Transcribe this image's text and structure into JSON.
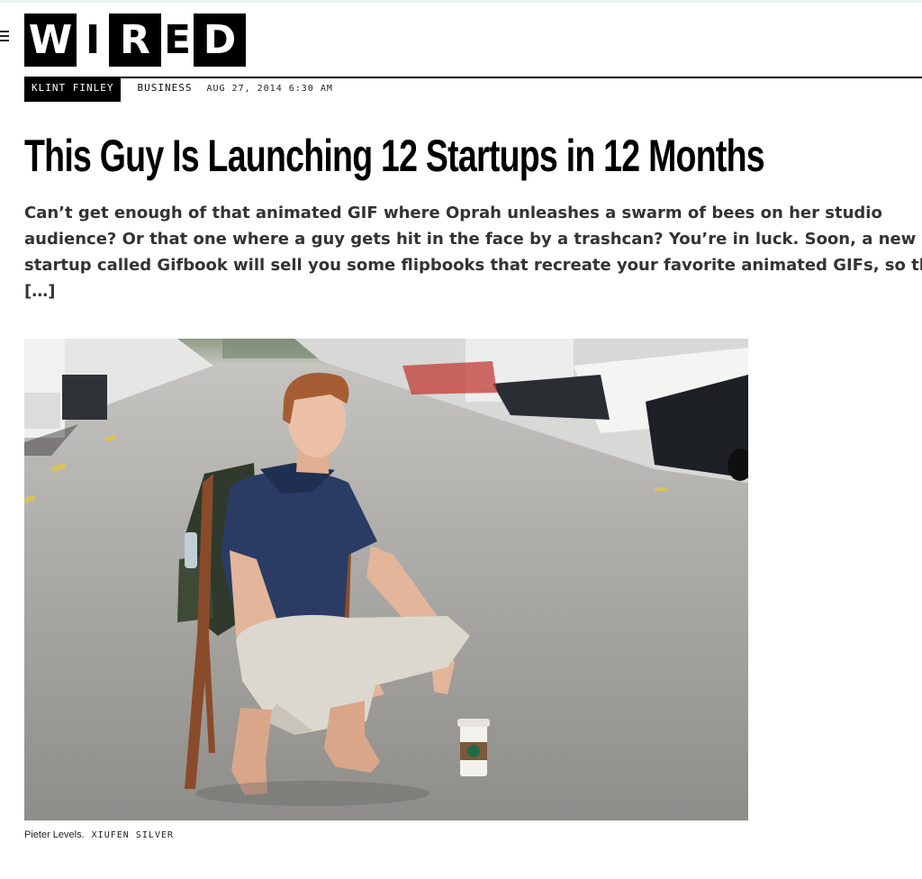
{
  "header": {
    "logo_letters": [
      "W",
      "I",
      "R",
      "E",
      "D"
    ],
    "menu_icon": "hamburger-menu-icon"
  },
  "article": {
    "author": "KLINT FINLEY",
    "section": "BUSINESS",
    "date": "AUG 27, 2014 6:30 AM",
    "headline": "This Guy Is Launching 12 Startups in 12 Months",
    "dek": "Can’t get enough of that animated GIF where Oprah unleashes a swarm of bees on her studio audience? Or that one where a guy gets hit in the face by a trashcan? You’re in luck. Soon, a new startup called Gifbook will sell you some flipbooks that recreate your favorite animated GIFs, so that […]"
  },
  "image": {
    "caption": "Pieter Levels.",
    "credit": "XIUFEN SILVER"
  },
  "colors": {
    "brand": "#000000",
    "text": "#111111",
    "dek": "#333333"
  }
}
